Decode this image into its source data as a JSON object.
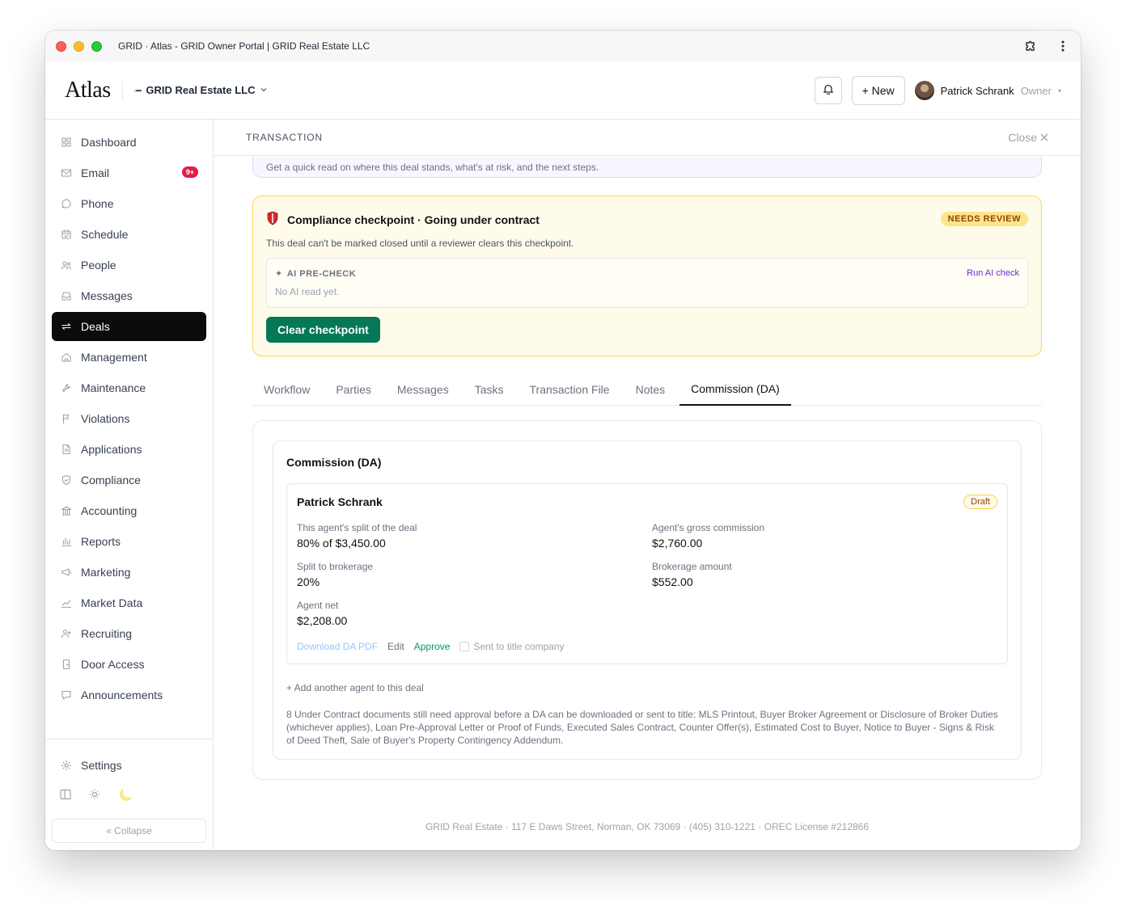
{
  "window": {
    "title": "GRID · Atlas - GRID Owner Portal | GRID Real Estate LLC"
  },
  "header": {
    "logo": "Atlas",
    "org_name": "GRID Real Estate LLC",
    "new_label": "+ New",
    "user_name": "Patrick Schrank",
    "user_role": "Owner"
  },
  "sidebar": {
    "items": [
      {
        "label": "Dashboard",
        "icon": "grid-icon"
      },
      {
        "label": "Email",
        "icon": "mail-icon",
        "badge": "9+"
      },
      {
        "label": "Phone",
        "icon": "phone-icon"
      },
      {
        "label": "Schedule",
        "icon": "calendar-icon"
      },
      {
        "label": "People",
        "icon": "people-icon"
      },
      {
        "label": "Messages",
        "icon": "inbox-icon"
      },
      {
        "label": "Deals",
        "icon": "deals-icon",
        "active": true
      },
      {
        "label": "Management",
        "icon": "home-icon"
      },
      {
        "label": "Maintenance",
        "icon": "wrench-icon"
      },
      {
        "label": "Violations",
        "icon": "flag-icon"
      },
      {
        "label": "Applications",
        "icon": "file-icon"
      },
      {
        "label": "Compliance",
        "icon": "shield-icon"
      },
      {
        "label": "Accounting",
        "icon": "bank-icon"
      },
      {
        "label": "Reports",
        "icon": "bar-chart-icon"
      },
      {
        "label": "Marketing",
        "icon": "megaphone-icon"
      },
      {
        "label": "Market Data",
        "icon": "line-chart-icon"
      },
      {
        "label": "Recruiting",
        "icon": "user-plus-icon"
      },
      {
        "label": "Door Access",
        "icon": "door-icon"
      },
      {
        "label": "Announcements",
        "icon": "announce-icon"
      }
    ],
    "settings_label": "Settings",
    "collapse_label": "« Collapse"
  },
  "transaction": {
    "title": "TRANSACTION",
    "close_label": "Close",
    "summary_text": "Get a quick read on where this deal stands, what's at risk, and the next steps."
  },
  "compliance": {
    "title": "Compliance checkpoint · Going under contract",
    "status": "NEEDS REVIEW",
    "subtitle": "This deal can't be marked closed until a reviewer clears this checkpoint.",
    "precheck_label": "AI PRE-CHECK",
    "run_label": "Run AI check",
    "empty_text": "No AI read yet.",
    "clear_label": "Clear checkpoint"
  },
  "tabs": [
    {
      "label": "Workflow"
    },
    {
      "label": "Parties"
    },
    {
      "label": "Messages"
    },
    {
      "label": "Tasks"
    },
    {
      "label": "Transaction File"
    },
    {
      "label": "Notes"
    },
    {
      "label": "Commission (DA)",
      "active": true
    }
  ],
  "commission": {
    "title": "Commission (DA)",
    "agent": {
      "name": "Patrick Schrank",
      "status": "Draft",
      "split_label": "This agent's split of the deal",
      "split_value": "80% of $3,450.00",
      "gross_label": "Agent's gross commission",
      "gross_value": "$2,760.00",
      "brokerage_split_label": "Split to brokerage",
      "brokerage_split_value": "20%",
      "brokerage_amount_label": "Brokerage amount",
      "brokerage_amount_value": "$552.00",
      "net_label": "Agent net",
      "net_value": "$2,208.00",
      "download_label": "Download DA PDF",
      "edit_label": "Edit",
      "approve_label": "Approve",
      "sent_label": "Sent to title company"
    },
    "add_agent_label": "+ Add another agent to this deal",
    "warning": "8 Under Contract documents still need approval before a DA can be downloaded or sent to title: MLS Printout, Buyer Broker Agreement or Disclosure of Broker Duties (whichever applies), Loan Pre-Approval Letter or Proof of Funds, Executed Sales Contract, Counter Offer(s), Estimated Cost to Buyer, Notice to Buyer - Signs & Risk of Deed Theft, Sale of Buyer's Property Contingency Addendum."
  },
  "footer": {
    "text": "GRID Real Estate · 117 E Daws Street, Norman, OK 73069 · (405) 310-1221 · OREC License #212866"
  }
}
